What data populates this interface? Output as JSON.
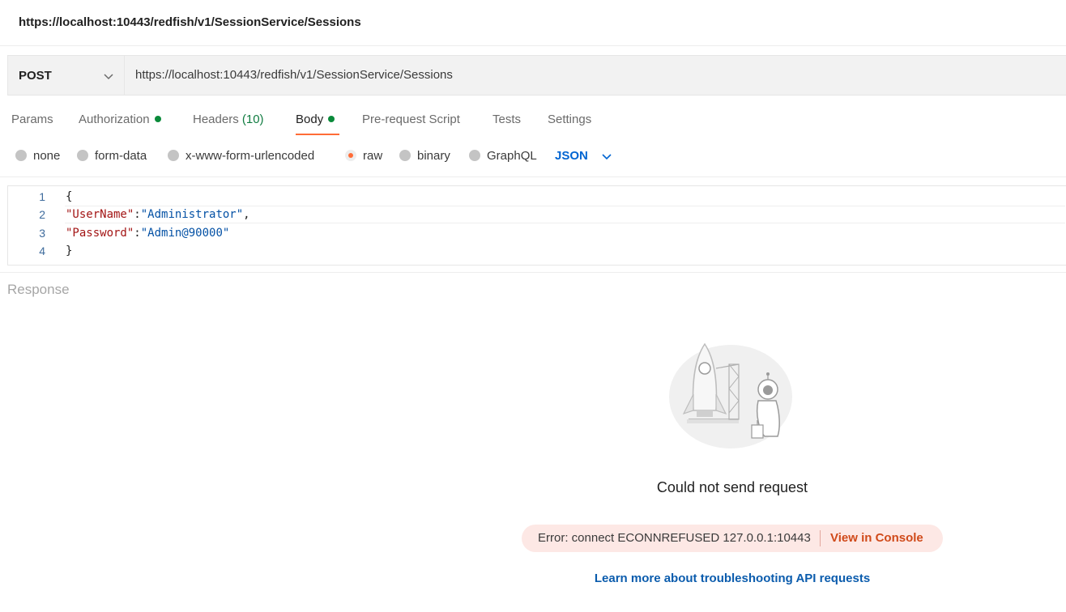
{
  "window": {
    "title": "https://localhost:10443/redfish/v1/SessionService/Sessions"
  },
  "request": {
    "method": "POST",
    "url": "https://localhost:10443/redfish/v1/SessionService/Sessions"
  },
  "tabs": {
    "params": "Params",
    "authorization": "Authorization",
    "headers": "Headers",
    "headers_count": "(10)",
    "body": "Body",
    "prerequest": "Pre-request Script",
    "tests": "Tests",
    "settings": "Settings",
    "active": "Body"
  },
  "body_types": {
    "none": "none",
    "form_data": "form-data",
    "urlencoded": "x-www-form-urlencoded",
    "raw": "raw",
    "binary": "binary",
    "graphql": "GraphQL",
    "selected": "raw",
    "format": "JSON"
  },
  "editor": {
    "line_numbers": [
      "1",
      "2",
      "3",
      "4"
    ],
    "open_brace": "{",
    "close_brace": "}",
    "fields": [
      {
        "key": "\"UserName\"",
        "value": "\"Administrator\"",
        "trail": ","
      },
      {
        "key": "\"Password\"",
        "value": "\"Admin@90000\"",
        "trail": ""
      }
    ],
    "colon": ":"
  },
  "response": {
    "label": "Response",
    "message": "Could not send request",
    "error": "Error: connect ECONNREFUSED 127.0.0.1:10443",
    "console_link": "View in Console",
    "help_link": "Learn more about troubleshooting API requests"
  },
  "colors": {
    "accent": "#ff6c37",
    "link": "#0265d2",
    "status_ok": "#0a8a3a",
    "error_bg": "#fde8e5"
  }
}
